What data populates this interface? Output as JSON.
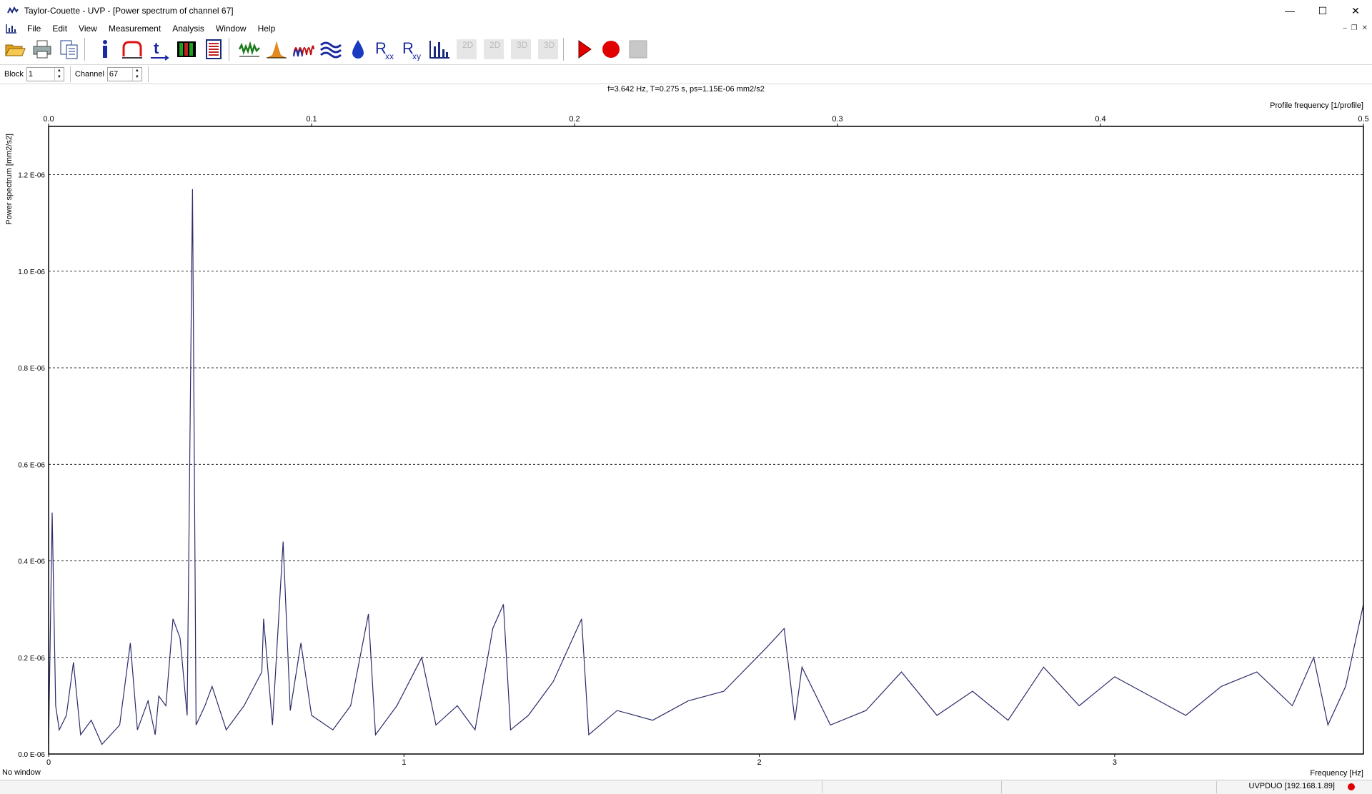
{
  "window": {
    "title": "Taylor-Couette - UVP - [Power spectrum of channel 67]",
    "minimize_glyph": "—",
    "maximize_glyph": "☐",
    "close_glyph": "✕"
  },
  "menu": [
    "File",
    "Edit",
    "View",
    "Measurement",
    "Analysis",
    "Window",
    "Help"
  ],
  "toolbar": {
    "buttons": [
      {
        "icon": "open-folder-icon"
      },
      {
        "icon": "print-icon"
      },
      {
        "icon": "copy-icon"
      },
      {
        "icon": "info-icon"
      },
      {
        "icon": "profile-icon"
      },
      {
        "icon": "time-icon"
      },
      {
        "icon": "color-bars-icon"
      },
      {
        "icon": "table-icon"
      },
      {
        "icon": "signal-icon"
      },
      {
        "icon": "histogram-peak-icon"
      },
      {
        "icon": "oscillation-icon"
      },
      {
        "icon": "waves-icon"
      },
      {
        "icon": "drop-icon"
      },
      {
        "icon": "rxx-icon"
      },
      {
        "icon": "rxy-icon"
      },
      {
        "icon": "bar-chart-icon"
      },
      {
        "icon": "2d-icon"
      },
      {
        "icon": "2d-alt-icon"
      },
      {
        "icon": "3d-icon"
      },
      {
        "icon": "3d-alt-icon"
      },
      {
        "icon": "play-icon"
      },
      {
        "icon": "record-icon"
      },
      {
        "icon": "stop-icon"
      }
    ]
  },
  "controls": {
    "block_label": "Block",
    "block_value": "1",
    "channel_label": "Channel",
    "channel_value": "67"
  },
  "status": {
    "left": "No window",
    "connection": "UVPDUO [192.168.1.89]"
  },
  "colors": {
    "trace": "#2b2b6b",
    "record": "#e00000",
    "play": "#e00000"
  },
  "chart_data": {
    "type": "line",
    "readout": "f=3.642 Hz,  T=0.275 s,  ps=1.15E-06 mm2/s2",
    "xlabel": "Frequency [Hz]",
    "x2label": "Profile frequency [1/profile]",
    "ylabel": "Power spectrum [mm2/s2]",
    "xlim": [
      0,
      3.7
    ],
    "x2lim": [
      0,
      0.5
    ],
    "ylim": [
      0,
      1.3e-06
    ],
    "xticks": [
      "0",
      "1",
      "2",
      "3"
    ],
    "x2ticks": [
      "0.0",
      "0.1",
      "0.2",
      "0.3",
      "0.4",
      "0.5"
    ],
    "yticks": [
      "0.0 E-06",
      "0.2 E-06",
      "0.4 E-06",
      "0.6 E-06",
      "0.8 E-06",
      "1.0 E-06",
      "1.2 E-06"
    ],
    "grid": "horizontal dashed",
    "series": [
      {
        "points": [
          [
            0.0,
            2e-08
          ],
          [
            0.01,
            5e-07
          ],
          [
            0.02,
            1e-07
          ],
          [
            0.03,
            5e-08
          ],
          [
            0.05,
            8e-08
          ],
          [
            0.07,
            1.9e-07
          ],
          [
            0.09,
            4e-08
          ],
          [
            0.12,
            7e-08
          ],
          [
            0.15,
            2e-08
          ],
          [
            0.2,
            6e-08
          ],
          [
            0.23,
            2.3e-07
          ],
          [
            0.25,
            5e-08
          ],
          [
            0.28,
            1.1e-07
          ],
          [
            0.3,
            4e-08
          ],
          [
            0.31,
            1.2e-07
          ],
          [
            0.33,
            1e-07
          ],
          [
            0.35,
            2.8e-07
          ],
          [
            0.37,
            2.4e-07
          ],
          [
            0.39,
            8e-08
          ],
          [
            0.405,
            1.17e-06
          ],
          [
            0.415,
            6e-08
          ],
          [
            0.44,
            1e-07
          ],
          [
            0.46,
            1.4e-07
          ],
          [
            0.5,
            5e-08
          ],
          [
            0.55,
            1e-07
          ],
          [
            0.6,
            1.7e-07
          ],
          [
            0.605,
            2.8e-07
          ],
          [
            0.63,
            6e-08
          ],
          [
            0.66,
            4.4e-07
          ],
          [
            0.68,
            9e-08
          ],
          [
            0.71,
            2.3e-07
          ],
          [
            0.74,
            8e-08
          ],
          [
            0.8,
            5e-08
          ],
          [
            0.85,
            1e-07
          ],
          [
            0.9,
            2.9e-07
          ],
          [
            0.92,
            4e-08
          ],
          [
            0.98,
            1e-07
          ],
          [
            1.05,
            2e-07
          ],
          [
            1.09,
            6e-08
          ],
          [
            1.15,
            1e-07
          ],
          [
            1.2,
            5e-08
          ],
          [
            1.25,
            2.6e-07
          ],
          [
            1.28,
            3.1e-07
          ],
          [
            1.3,
            5e-08
          ],
          [
            1.35,
            8e-08
          ],
          [
            1.42,
            1.5e-07
          ],
          [
            1.5,
            2.8e-07
          ],
          [
            1.52,
            4e-08
          ],
          [
            1.6,
            9e-08
          ],
          [
            1.7,
            7e-08
          ],
          [
            1.8,
            1.1e-07
          ],
          [
            1.9,
            1.3e-07
          ],
          [
            2.02,
            2.2e-07
          ],
          [
            2.07,
            2.6e-07
          ],
          [
            2.1,
            7e-08
          ],
          [
            2.12,
            1.8e-07
          ],
          [
            2.2,
            6e-08
          ],
          [
            2.3,
            9e-08
          ],
          [
            2.4,
            1.7e-07
          ],
          [
            2.5,
            8e-08
          ],
          [
            2.6,
            1.3e-07
          ],
          [
            2.7,
            7e-08
          ],
          [
            2.8,
            1.8e-07
          ],
          [
            2.9,
            1e-07
          ],
          [
            3.0,
            1.6e-07
          ],
          [
            3.1,
            1.2e-07
          ],
          [
            3.2,
            8e-08
          ],
          [
            3.3,
            1.4e-07
          ],
          [
            3.4,
            1.7e-07
          ],
          [
            3.5,
            1e-07
          ],
          [
            3.56,
            2e-07
          ],
          [
            3.6,
            6e-08
          ],
          [
            3.65,
            1.4e-07
          ],
          [
            3.7,
            3.1e-07
          ]
        ]
      }
    ]
  }
}
